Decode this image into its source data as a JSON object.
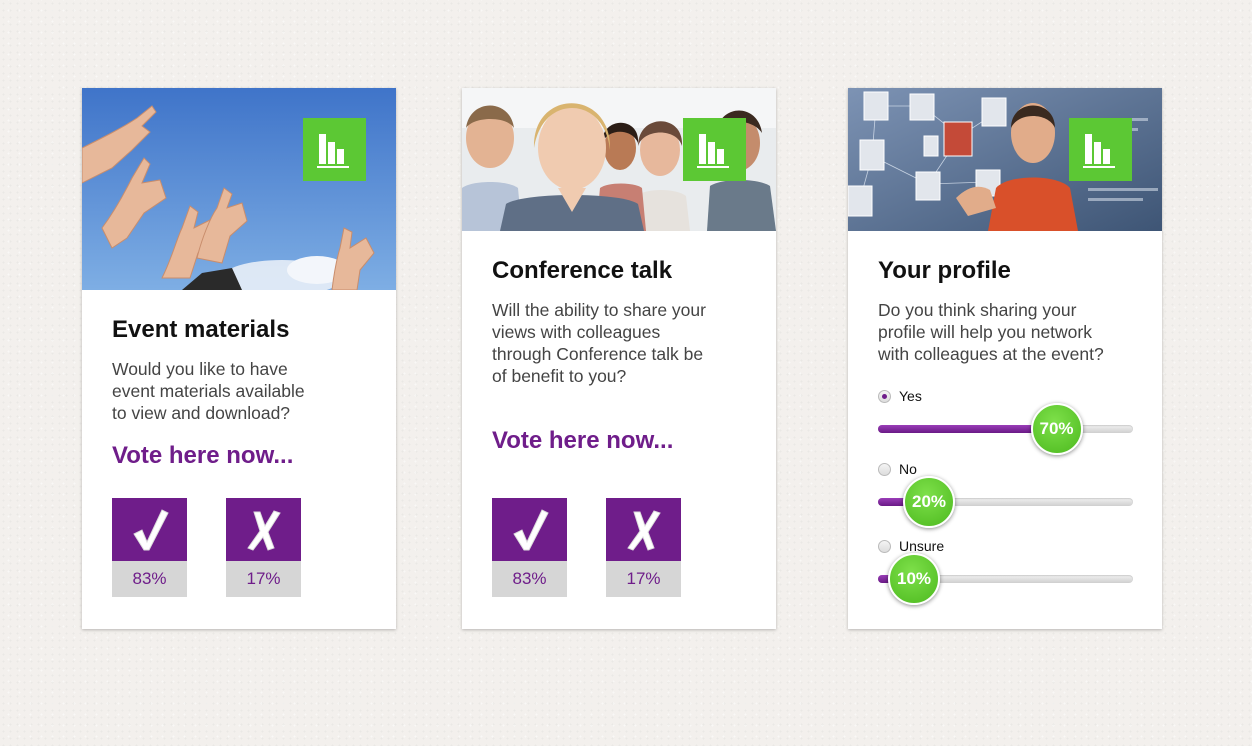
{
  "colors": {
    "accent": "#6f1d8a",
    "badge_green": "#5cc834",
    "knob_green": "#4cb91e",
    "vote_bg_gray": "#d6d6d6"
  },
  "cards": [
    {
      "title": "Event materials",
      "question_lines": [
        "Would you like to have",
        "event materials available",
        "to view and download?"
      ],
      "cta": "Vote here now...",
      "vote_yes_icon": "✔",
      "vote_no_icon": "✗",
      "vote_yes_pct": "83%",
      "vote_no_pct": "17%",
      "poll_icon": "bar-chart-icon"
    },
    {
      "title": "Conference talk",
      "question_lines": [
        "Will the ability to share your",
        "views with colleagues",
        "through Conference talk be",
        "of benefit to you?"
      ],
      "cta": "Vote here now...",
      "vote_yes_icon": "✔",
      "vote_no_icon": "✗",
      "vote_yes_pct": "83%",
      "vote_no_pct": "17%",
      "poll_icon": "bar-chart-icon"
    },
    {
      "title": "Your profile",
      "question_lines": [
        "Do you think sharing your",
        "profile will help you network",
        "with colleagues at the event?"
      ],
      "poll_icon": "bar-chart-icon",
      "options": [
        {
          "label": "Yes",
          "checked": true,
          "value_pct": 70,
          "value_label": "70%"
        },
        {
          "label": "No",
          "checked": false,
          "value_pct": 20,
          "value_label": "20%"
        },
        {
          "label": "Unsure",
          "checked": false,
          "value_pct": 10,
          "value_label": "10%"
        }
      ]
    }
  ]
}
